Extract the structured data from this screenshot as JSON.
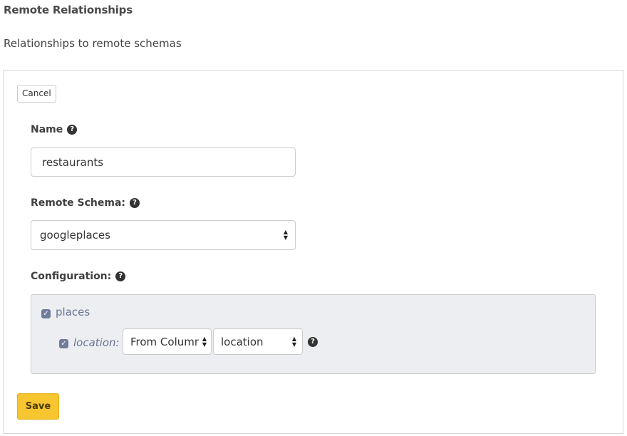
{
  "header": {
    "title": "Remote Relationships",
    "subtitle": "Relationships to remote schemas"
  },
  "form": {
    "cancel_label": "Cancel",
    "name": {
      "label": "Name",
      "value": "restaurants"
    },
    "remote_schema": {
      "label": "Remote Schema:",
      "selected": "googleplaces"
    },
    "configuration": {
      "label": "Configuration:",
      "root_field": {
        "label": "places",
        "checked": true
      },
      "argument": {
        "label": "location:",
        "checked": true,
        "source_selected": "From Column",
        "column_selected": "location"
      }
    },
    "save_label": "Save"
  },
  "icons": {
    "help": "question-circle-icon",
    "check": "checkmark-icon",
    "select_arrows": "updown-arrows-icon"
  },
  "colors": {
    "save_button": "#f7c52f",
    "config_bg": "#eceef1",
    "checkbox": "#6f7c9a"
  }
}
